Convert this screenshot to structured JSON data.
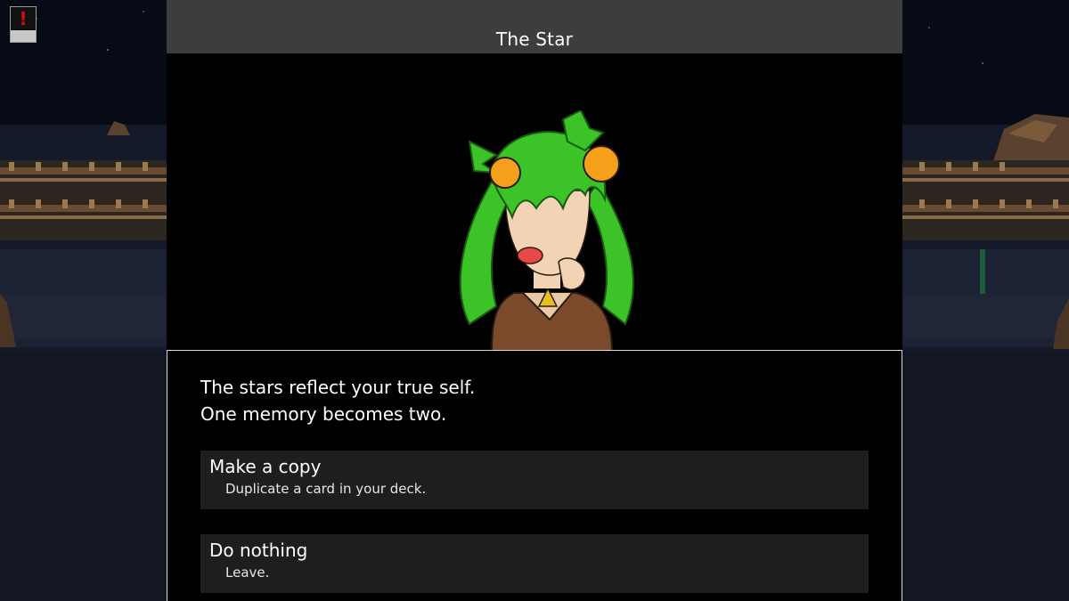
{
  "event": {
    "title": "The Star",
    "description_lines": [
      "The stars reflect your true self.",
      "One memory becomes two."
    ]
  },
  "choices": [
    {
      "label": "Make a copy",
      "description": "Duplicate a card in your deck."
    },
    {
      "label": "Do nothing",
      "description": "Leave."
    }
  ],
  "icons": {
    "alert": "exclamation-icon"
  },
  "colors": {
    "title_bar": "#3d3d3d",
    "choice_bg": "#1e1e1e",
    "hair": "#3cc328",
    "hair_ornament": "#f5a01a",
    "alert_mark": "#d01010"
  }
}
